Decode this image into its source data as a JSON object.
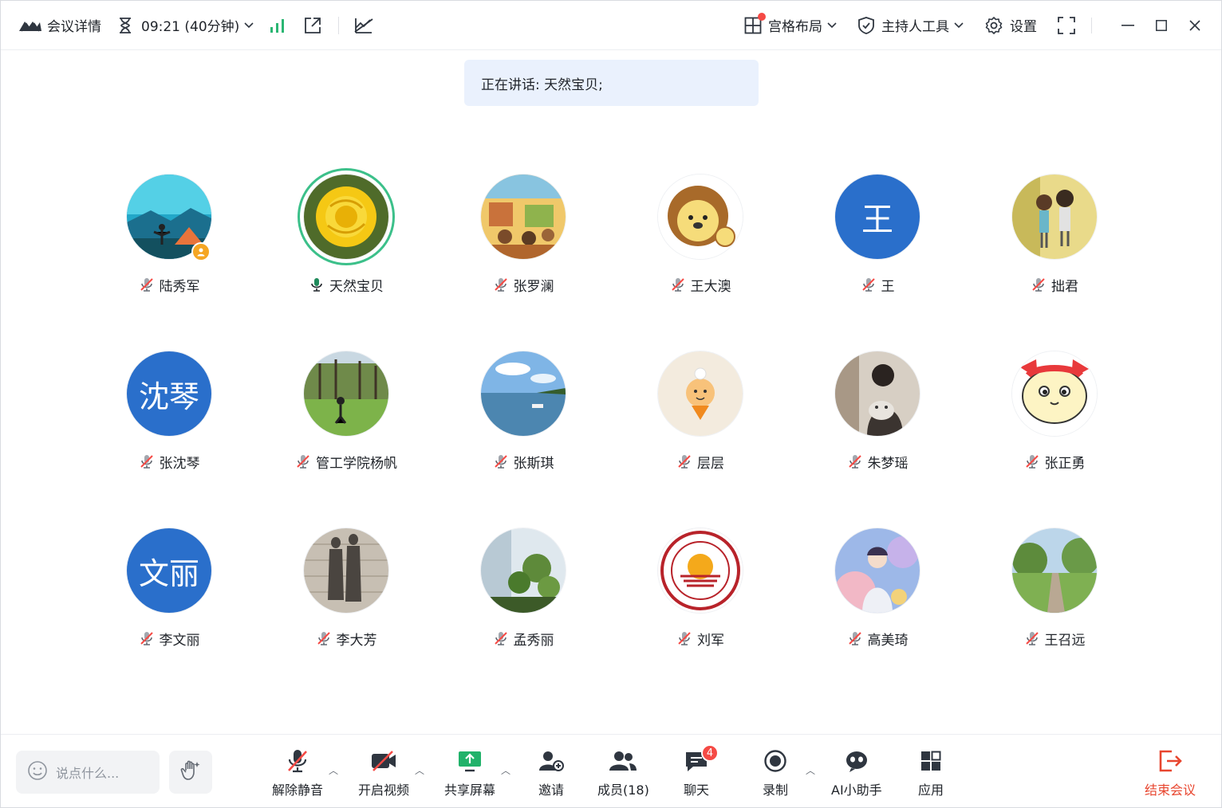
{
  "topbar": {
    "meeting_details": "会议详情",
    "time": "09:21 (40分钟)",
    "layout_label": "宫格布局",
    "host_tools_label": "主持人工具",
    "settings_label": "设置"
  },
  "speaking": {
    "text": "正在讲话: 天然宝贝;"
  },
  "participants": [
    {
      "name": "陆秀军"
    },
    {
      "name": "天然宝贝"
    },
    {
      "name": "张罗澜"
    },
    {
      "name": "王大澳"
    },
    {
      "name": "王",
      "avatar_text": "王"
    },
    {
      "name": "拙君"
    },
    {
      "name": "张沈琴",
      "avatar_text": "沈琴"
    },
    {
      "name": "管工学院杨帆"
    },
    {
      "name": "张斯琪"
    },
    {
      "name": "层层"
    },
    {
      "name": "朱梦瑶"
    },
    {
      "name": "张正勇"
    },
    {
      "name": "李文丽",
      "avatar_text": "文丽"
    },
    {
      "name": "李大芳"
    },
    {
      "name": "孟秀丽"
    },
    {
      "name": "刘军"
    },
    {
      "name": "高美琦"
    },
    {
      "name": "王召远"
    }
  ],
  "bottombar": {
    "chat_placeholder": "说点什么...",
    "unmute": "解除静音",
    "start_video": "开启视频",
    "share_screen": "共享屏幕",
    "invite": "邀请",
    "members": "成员(18)",
    "chat": "聊天",
    "chat_badge": "4",
    "record": "录制",
    "ai_assistant": "AI小助手",
    "apps": "应用",
    "end_meeting": "结束会议"
  },
  "colors": {
    "accent_blue": "#2a6fcb",
    "speaking_green": "#3cc08a",
    "alert_red": "#f54a45",
    "end_red": "#e8462f"
  }
}
